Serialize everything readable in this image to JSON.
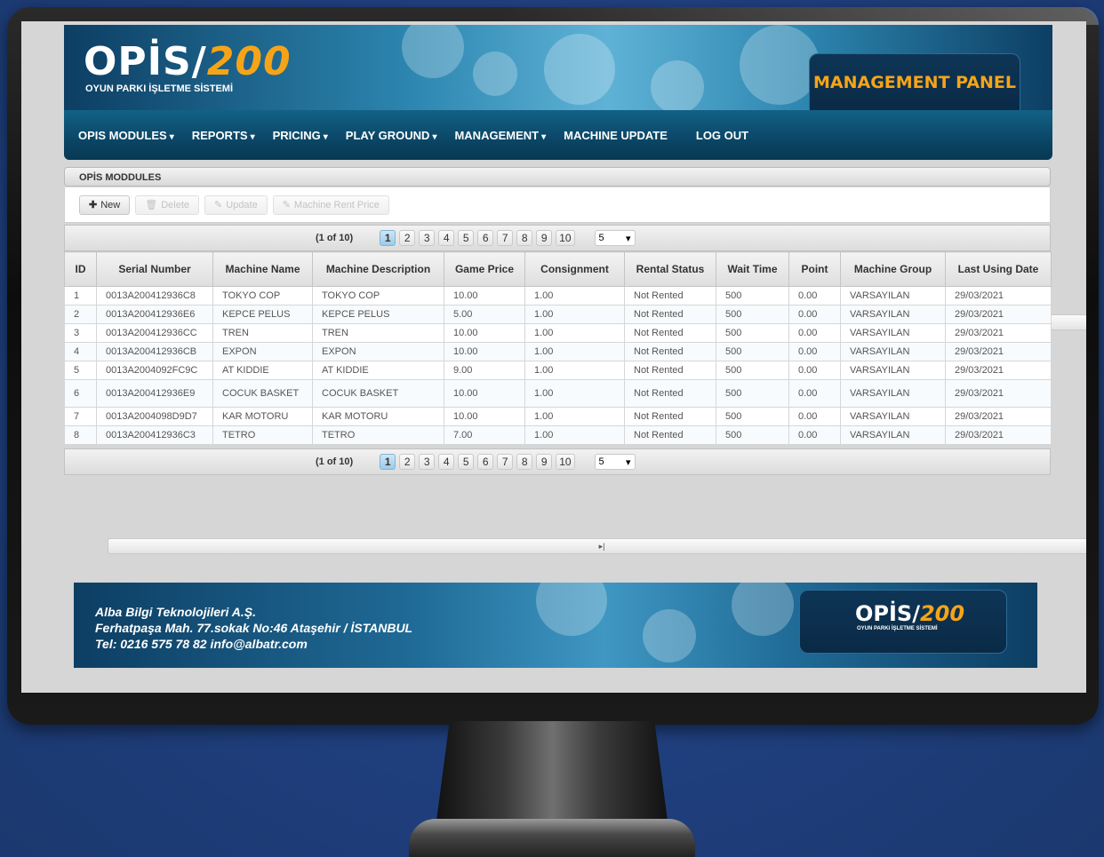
{
  "header": {
    "logo_text": "OPİS/",
    "logo_number": "200",
    "logo_subtitle": "OYUN PARKI İŞLETME SİSTEMİ",
    "panel_label": "MANAGEMENT PANEL"
  },
  "nav": {
    "items": [
      {
        "label": "OPIS MODULES",
        "dropdown": "▾"
      },
      {
        "label": "REPORTS",
        "dropdown": "▾"
      },
      {
        "label": "PRICING",
        "dropdown": "▾"
      },
      {
        "label": "PLAY GROUND",
        "dropdown": "▾"
      },
      {
        "label": "MANAGEMENT",
        "dropdown": "▾"
      },
      {
        "label": "MACHINE UPDATE"
      },
      {
        "label": "LOG OUT"
      }
    ]
  },
  "panel": {
    "title": "OPİS MODDULES"
  },
  "toolbar": {
    "new_label": "New",
    "delete_label": "Delete",
    "update_label": "Update",
    "machine_rent_price_label": "Machine Rent Price"
  },
  "pager": {
    "count_text": "(1 of 10)",
    "first": "|◂",
    "prev": "◂◂",
    "next": "▸▸",
    "last": "▸|",
    "pages": [
      "1",
      "2",
      "3",
      "4",
      "5",
      "6",
      "7",
      "8",
      "9",
      "10"
    ],
    "current_page": "1",
    "rows_per_page": "5"
  },
  "table": {
    "headers": {
      "id": "ID",
      "serial": "Serial Number",
      "machine_name": "Machine Name",
      "machine_description": "Machine Description",
      "game_price": "Game Price",
      "consignment": "Consignment",
      "rental_status": "Rental Status",
      "wait_time": "Wait Time",
      "point": "Point",
      "machine_group": "Machine Group",
      "last_using_date": "Last Using Date"
    },
    "rows": [
      {
        "id": "1",
        "serial": "0013A2004129​36C8",
        "name": "TOKYO COP",
        "desc": "TOKYO COP",
        "price": "10.00",
        "consignment": "1.00",
        "status": "Not Rented",
        "wait": "500",
        "point": "0.00",
        "group": "VARSAYILAN",
        "date": "29/03/2021"
      },
      {
        "id": "2",
        "serial": "0013A200412936E6",
        "name": "KEPCE PELUS",
        "desc": "KEPCE PELUS",
        "price": "5.00",
        "consignment": "1.00",
        "status": "Not Rented",
        "wait": "500",
        "point": "0.00",
        "group": "VARSAYILAN",
        "date": "29/03/2021"
      },
      {
        "id": "3",
        "serial": "0013A200412936CC",
        "name": "TREN",
        "desc": "TREN",
        "price": "10.00",
        "consignment": "1.00",
        "status": "Not Rented",
        "wait": "500",
        "point": "0.00",
        "group": "VARSAYILAN",
        "date": "29/03/2021"
      },
      {
        "id": "4",
        "serial": "0013A200412936CB",
        "name": "EXPON",
        "desc": "EXPON",
        "price": "10.00",
        "consignment": "1.00",
        "status": "Not Rented",
        "wait": "500",
        "point": "0.00",
        "group": "VARSAYILAN",
        "date": "29/03/2021"
      },
      {
        "id": "5",
        "serial": "0013A2004092FC9C",
        "name": "AT KIDDIE",
        "desc": "AT KIDDIE",
        "price": "9.00",
        "consignment": "1.00",
        "status": "Not Rented",
        "wait": "500",
        "point": "0.00",
        "group": "VARSAYILAN",
        "date": "29/03/2021"
      },
      {
        "id": "6",
        "serial": "0013A200412936E9",
        "name": "COCUK BASKET",
        "desc": "COCUK BASKET",
        "price": "10.00",
        "consignment": "1.00",
        "status": "Not Rented",
        "wait": "500",
        "point": "0.00",
        "group": "VARSAYILAN",
        "date": "29/03/2021"
      },
      {
        "id": "7",
        "serial": "0013A2004098D9D7",
        "name": "KAR MOTORU",
        "desc": "KAR MOTORU",
        "price": "10.00",
        "consignment": "1.00",
        "status": "Not Rented",
        "wait": "500",
        "point": "0.00",
        "group": "VARSAYILAN",
        "date": "29/03/2021"
      },
      {
        "id": "8",
        "serial": "0013A200412936C3",
        "name": "TETRO",
        "desc": "TETRO",
        "price": "7.00",
        "consignment": "1.00",
        "status": "Not Rented",
        "wait": "500",
        "point": "0.00",
        "group": "VARSAYILAN",
        "date": "29/03/2021"
      }
    ]
  },
  "footer": {
    "company": "Alba Bilgi Teknolojileri A.Ş.",
    "address": "Ferhatpaşa Mah. 77.sokak No:46 Ataşehir / İSTANBUL",
    "contact": "Tel: 0216 575 78 82  info@albatr.com",
    "logo_text": "OPİS/",
    "logo_number": "200",
    "logo_subtitle": "OYUN PARKI İŞLETME SİSTEMİ"
  },
  "colors": {
    "brand_orange": "#f6a417",
    "nav_blue": "#0b4666",
    "background_blue": "#1f3f7e"
  }
}
